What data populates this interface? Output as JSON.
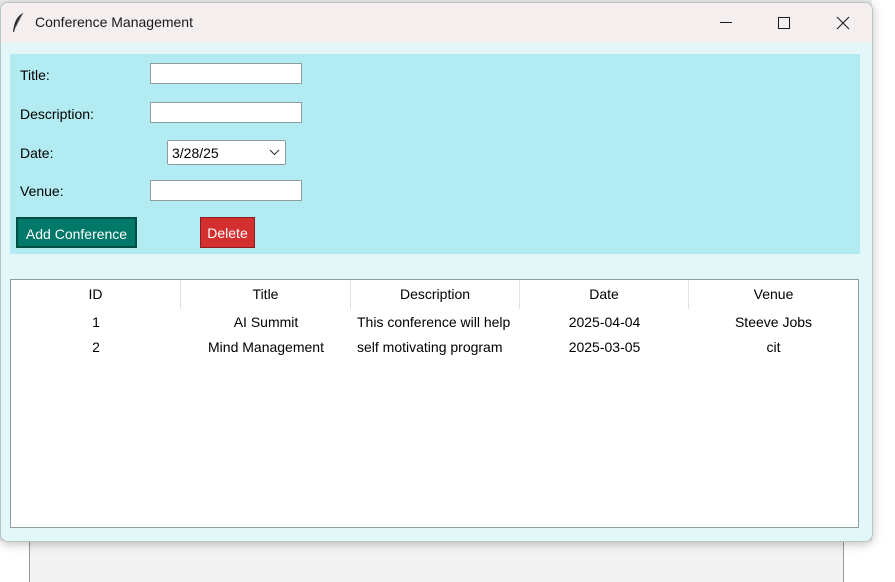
{
  "window": {
    "title": "Conference Management"
  },
  "form": {
    "title_label": "Title:",
    "title_value": "",
    "description_label": "Description:",
    "description_value": "",
    "date_label": "Date:",
    "date_value": "3/28/25",
    "venue_label": "Venue:",
    "venue_value": "",
    "add_button": "Add Conference",
    "delete_button": "Delete"
  },
  "table": {
    "columns": [
      "ID",
      "Title",
      "Description",
      "Date",
      "Venue"
    ],
    "rows": [
      [
        "1",
        "AI Summit",
        "This conference will help",
        "2025-04-04",
        "Steeve Jobs"
      ],
      [
        "2",
        "Mind Management",
        "self motivating program",
        "2025-03-05",
        "cit"
      ]
    ]
  },
  "colors": {
    "form_panel": "#b2ebf2",
    "window_bg": "#e3f7f8",
    "add_button": "#00796b",
    "delete_button": "#d32f2f"
  },
  "icons": {
    "app": "feather-icon",
    "minimize": "minimize-icon",
    "maximize": "maximize-icon",
    "close": "close-icon",
    "dropdown": "chevron-down-icon"
  }
}
